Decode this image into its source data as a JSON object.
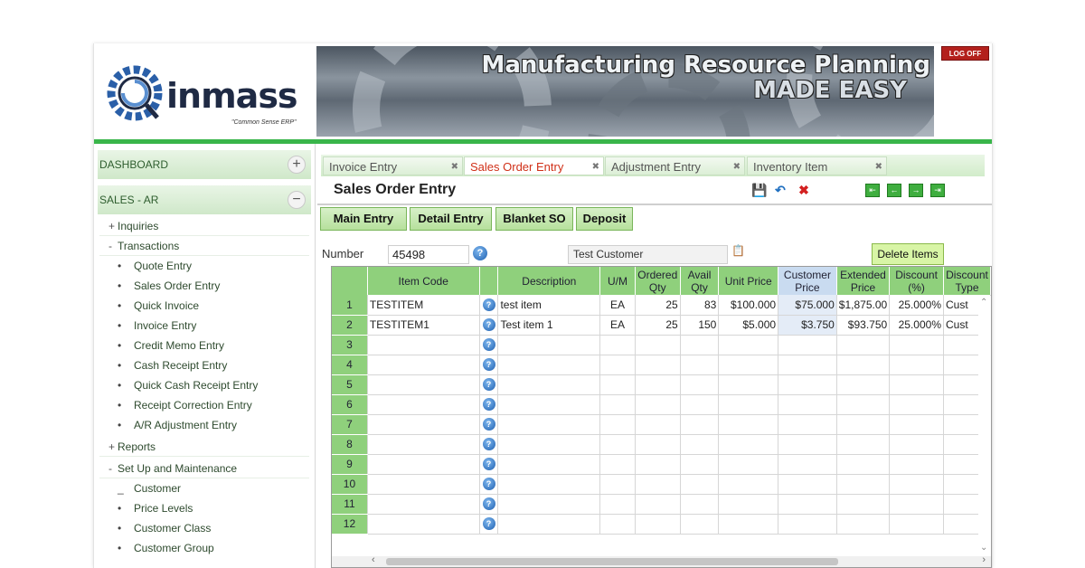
{
  "header": {
    "logo_text": "inmass",
    "logo_tagline": "\"Common Sense ERP\"",
    "banner_line1": "Manufacturing Resource Planning",
    "banner_line2": "MADE EASY",
    "logoff_label": "LOG OFF"
  },
  "sidebar": {
    "sections": [
      {
        "label": "DASHBOARD",
        "toggle": "+"
      },
      {
        "label": "SALES - AR",
        "toggle": "−"
      }
    ],
    "items": [
      {
        "marker": "+",
        "label": "Inquiries"
      },
      {
        "marker": "-",
        "label": "Transactions"
      }
    ],
    "transactions": [
      "Quote Entry",
      "Sales Order Entry",
      "Quick Invoice",
      "Invoice Entry",
      "Credit Memo Entry",
      "Cash Receipt Entry",
      "Quick Cash Receipt Entry",
      "Receipt Correction Entry",
      "A/R Adjustment Entry"
    ],
    "reports": {
      "marker": "+",
      "label": "Reports"
    },
    "setup": {
      "marker": "-",
      "label": "Set Up and Maintenance"
    },
    "setup_items": [
      "Customer",
      "Price Levels",
      "Customer Class",
      "Customer Group"
    ]
  },
  "tabs": [
    {
      "label": "Invoice Entry",
      "close": "✖"
    },
    {
      "label": "Sales Order Entry",
      "close": "✖"
    },
    {
      "label": "Adjustment Entry",
      "close": "✖"
    },
    {
      "label": "Inventory Item",
      "close": "✖"
    }
  ],
  "page": {
    "title": "Sales Order Entry",
    "subtabs": [
      "Main Entry",
      "Detail Entry",
      "Blanket SO",
      "Deposit"
    ],
    "number_label": "Number",
    "number_value": "45498",
    "customer_value": "Test Customer",
    "delete_button": "Delete Items"
  },
  "toolbar_icons": [
    "save-icon",
    "undo-icon",
    "delete-icon",
    "first-record-icon",
    "previous-record-icon",
    "next-record-icon",
    "last-record-icon"
  ],
  "grid": {
    "headers": [
      "",
      "Item Code",
      "",
      "Description",
      "U/M",
      "Ordered Qty",
      "Avail Qty",
      "Unit Price",
      "Customer Price",
      "Extended Price",
      "Discount (%)",
      "Discount Type"
    ],
    "rows": [
      {
        "n": "1",
        "item": "TESTITEM",
        "desc": "test item",
        "um": "EA",
        "ord": "25",
        "avail": "83",
        "unit": "$100.000",
        "cust": "$75.000",
        "ext": "$1,875.00",
        "disc": "25.000%",
        "dtype": "Cust"
      },
      {
        "n": "2",
        "item": "TESTITEM1",
        "desc": "Test item 1",
        "um": "EA",
        "ord": "25",
        "avail": "150",
        "unit": "$5.000",
        "cust": "$3.750",
        "ext": "$93.750",
        "disc": "25.000%",
        "dtype": "Cust"
      },
      {
        "n": "3"
      },
      {
        "n": "4"
      },
      {
        "n": "5"
      },
      {
        "n": "6"
      },
      {
        "n": "7"
      },
      {
        "n": "8"
      },
      {
        "n": "9"
      },
      {
        "n": "10"
      },
      {
        "n": "11"
      },
      {
        "n": "12"
      }
    ]
  },
  "colors": {
    "accent_green": "#39b54a",
    "header_green": "#8fd07c",
    "active_tab_text": "#d03018",
    "logoff_red": "#b3201c"
  }
}
